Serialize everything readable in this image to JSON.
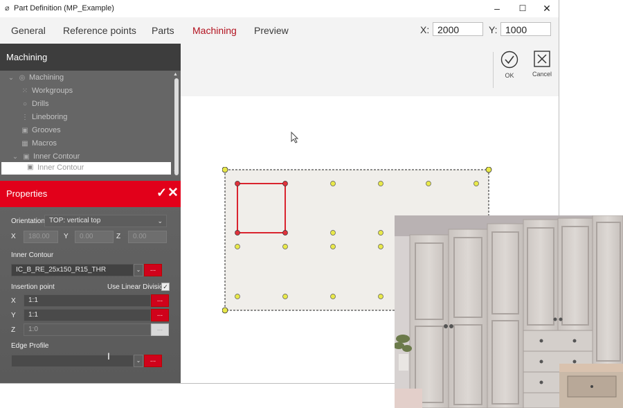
{
  "window": {
    "title": "Part Definition (MP_Example)"
  },
  "window_controls": {
    "minimize": "–",
    "maximize": "☐",
    "close": "✕"
  },
  "tabs": [
    {
      "label": "General"
    },
    {
      "label": "Reference points"
    },
    {
      "label": "Parts"
    },
    {
      "label": "Machining"
    },
    {
      "label": "Preview"
    }
  ],
  "coords": {
    "x_label": "X:",
    "x_value": "2000",
    "y_label": "Y:",
    "y_value": "1000"
  },
  "left_panel": {
    "header": "Machining",
    "tree": [
      {
        "label": "Machining"
      },
      {
        "label": "Workgroups"
      },
      {
        "label": "Drills"
      },
      {
        "label": "Lineboring"
      },
      {
        "label": "Grooves"
      },
      {
        "label": "Macros"
      },
      {
        "label": "Inner Contour"
      },
      {
        "label": "Inner Contour"
      }
    ]
  },
  "properties": {
    "header": "Properties",
    "orientation_label": "Orientation",
    "orientation_value": "TOP: vertical top",
    "x_label": "X",
    "x_value": "180.00",
    "y_label": "Y",
    "y_value": "0.00",
    "z_label": "Z",
    "z_value": "0.00",
    "inner_contour_label": "Inner Contour",
    "inner_contour_value": "IC_B_RE_25x150_R15_THR",
    "insertion_point_label": "Insertion point",
    "linear_division_label": "Use Linear Division",
    "ins_x_label": "X",
    "ins_x_value": "1:1",
    "ins_y_label": "Y",
    "ins_y_value": "1:1",
    "ins_z_label": "Z",
    "ins_z_value": "1:0",
    "edge_profile_label": "Edge Profile",
    "edge_profile_value": "",
    "dots_label": "..."
  },
  "toolbar": {
    "ok_label": "OK",
    "cancel_label": "Cancel"
  },
  "colors": {
    "accent": "#b3121f",
    "header_red": "#e2001a",
    "contour_red": "#d9232e",
    "point_yellow": "#e8e84a"
  }
}
